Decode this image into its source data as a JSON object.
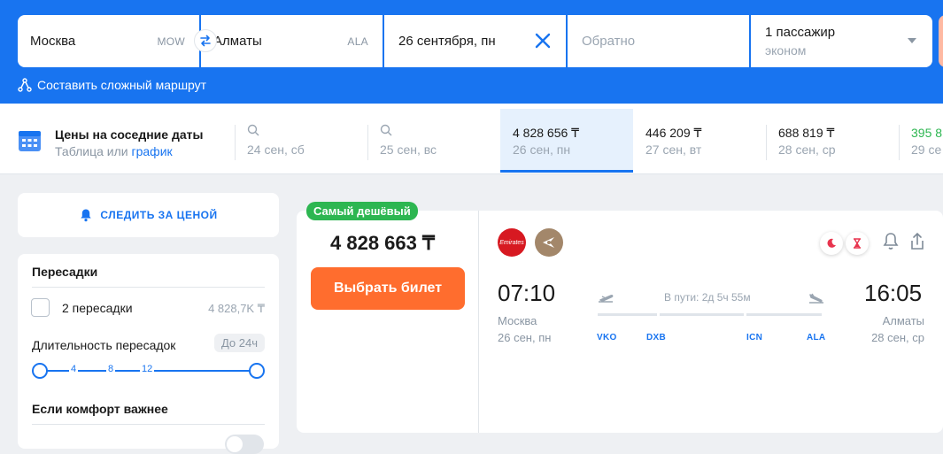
{
  "search": {
    "origin_city": "Москва",
    "origin_code": "MOW",
    "destination_city": "Алматы",
    "destination_code": "ALA",
    "date": "26 сентября, пн",
    "return_placeholder": "Обратно",
    "passengers": "1 пассажир",
    "cabin_class": "эконом",
    "complex_route_link": "Составить сложный маршрут"
  },
  "nearby_dates": {
    "title": "Цены на соседние даты",
    "sub_table": "Таблица",
    "sub_or": " или ",
    "sub_chart": "график",
    "cells": [
      {
        "price": "",
        "day": "24 сен, сб"
      },
      {
        "price": "",
        "day": "25 сен, вс"
      },
      {
        "price": "4 828 656 ₸",
        "day": "26 сен, пн"
      },
      {
        "price": "446 209 ₸",
        "day": "27 сен, вт"
      },
      {
        "price": "688 819 ₸",
        "day": "28 сен, ср"
      },
      {
        "price": "395 8",
        "day": "29 се"
      }
    ]
  },
  "sidebar": {
    "watch_price": "СЛЕДИТЬ ЗА ЦЕНОЙ",
    "transfers_title": "Пересадки",
    "transfers_option": "2 пересадки",
    "transfers_price": "4 828,7K ₸",
    "duration_title": "Длительность пересадок",
    "duration_badge": "До 24ч",
    "duration_ticks": [
      "4",
      "8",
      "12"
    ],
    "comfort_title": "Если комфорт важнее"
  },
  "ticket": {
    "cheapest_badge": "Самый дешёвый",
    "price": "4 828 663 ₸",
    "buy_button": "Выбрать билет",
    "airline_logo_text": "Emirates",
    "departure_time": "07:10",
    "arrival_time": "16:05",
    "departure_city": "Москва",
    "departure_date": "26 сен, пн",
    "arrival_city": "Алматы",
    "arrival_date": "28 сен, ср",
    "duration": "В пути: 2д 5ч 55м",
    "stops": [
      "VKO",
      "DXB",
      "ICN",
      "ALA"
    ]
  },
  "colors": {
    "brand_blue": "#1874f0",
    "accent_orange": "#ff6d2e",
    "cheapest_green": "#2db651"
  }
}
